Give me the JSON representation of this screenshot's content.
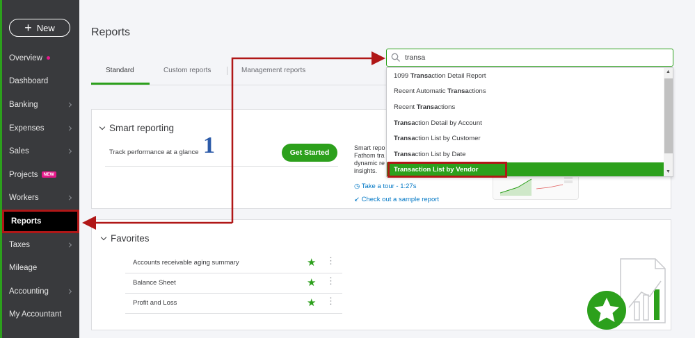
{
  "sidebar": {
    "new_button": "New",
    "items": [
      {
        "label": "Overview"
      },
      {
        "label": "Dashboard"
      },
      {
        "label": "Banking"
      },
      {
        "label": "Expenses"
      },
      {
        "label": "Sales"
      },
      {
        "label": "Projects",
        "badge": "NEW"
      },
      {
        "label": "Workers"
      },
      {
        "label": "Reports"
      },
      {
        "label": "Taxes"
      },
      {
        "label": "Mileage"
      },
      {
        "label": "Accounting"
      },
      {
        "label": "My Accountant"
      }
    ]
  },
  "page": {
    "title": "Reports",
    "tabs": [
      "Standard",
      "Custom reports",
      "Management reports"
    ]
  },
  "search": {
    "value": "transa",
    "results": [
      {
        "pre": "1099 ",
        "match": "Transa",
        "post": "ction Detail Report"
      },
      {
        "pre": "Recent Automatic ",
        "match": "Transa",
        "post": "ctions"
      },
      {
        "pre": "Recent ",
        "match": "Transa",
        "post": "ctions"
      },
      {
        "pre": "",
        "match": "Transa",
        "post": "ction Detail by Account"
      },
      {
        "pre": "",
        "match": "Transa",
        "post": "ction List by Customer"
      },
      {
        "pre": "",
        "match": "Transa",
        "post": "ction List by Date"
      },
      {
        "pre": "",
        "match": "Transa",
        "post": "ction List by Vendor"
      }
    ]
  },
  "smart_reporting": {
    "heading": "Smart reporting",
    "track_text": "Track performance at a glance",
    "step_number": "1",
    "button": "Get Started",
    "desc_lines": [
      "Smart repo",
      "Fathom tra",
      "dynamic re",
      "insights."
    ],
    "tour_link": "Take a tour - 1:27s",
    "sample_link": "Check out a sample report"
  },
  "favorites": {
    "heading": "Favorites",
    "items": [
      "Accounts receivable aging summary",
      "Balance Sheet",
      "Profit and Loss"
    ]
  },
  "colors": {
    "brand_green": "#2ca01c",
    "sidebar_bg": "#393a3d",
    "annotation_red": "#b01717",
    "link_blue": "#0077c5"
  }
}
